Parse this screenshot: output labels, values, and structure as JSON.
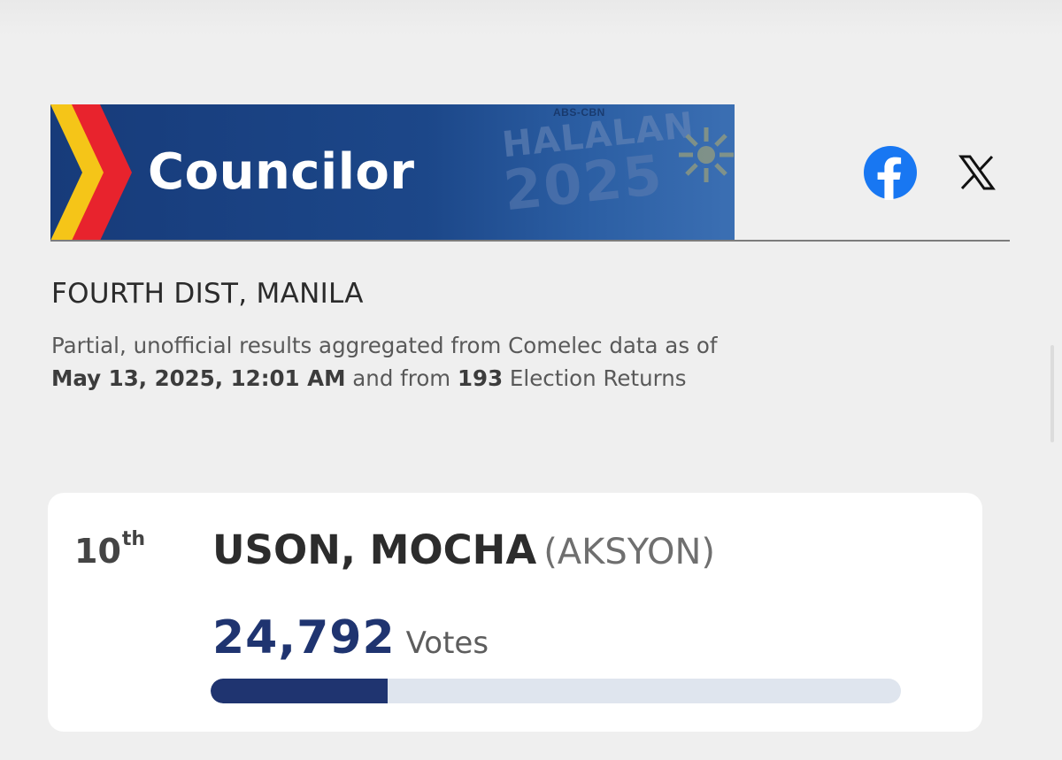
{
  "header": {
    "title": "Councilor",
    "logo_small": "ABS-CBN",
    "logo_main": "HALALAN",
    "logo_year": "2025",
    "social": [
      "facebook-icon",
      "x-icon"
    ]
  },
  "district": "FOURTH DIST, MANILA",
  "info": {
    "prefix": "Partial, unofficial results aggregated from Comelec data as of ",
    "date": "May 13, 2025, 12:01 AM",
    "middle": " and from ",
    "returns_count": "193",
    "suffix": " Election Returns"
  },
  "result": {
    "rank": "10",
    "rank_suffix": "th",
    "name": "USON, MOCHA",
    "party": "(AKSYON)",
    "votes": "24,792",
    "votes_label": "Votes",
    "progress_fraction": 0.257
  },
  "colors": {
    "banner": "#1c4789",
    "accent_red": "#e8232d",
    "accent_yellow": "#f5c518",
    "votes_navy": "#1f3470",
    "bar_track": "#dfe5ee",
    "facebook": "#1877f2"
  }
}
